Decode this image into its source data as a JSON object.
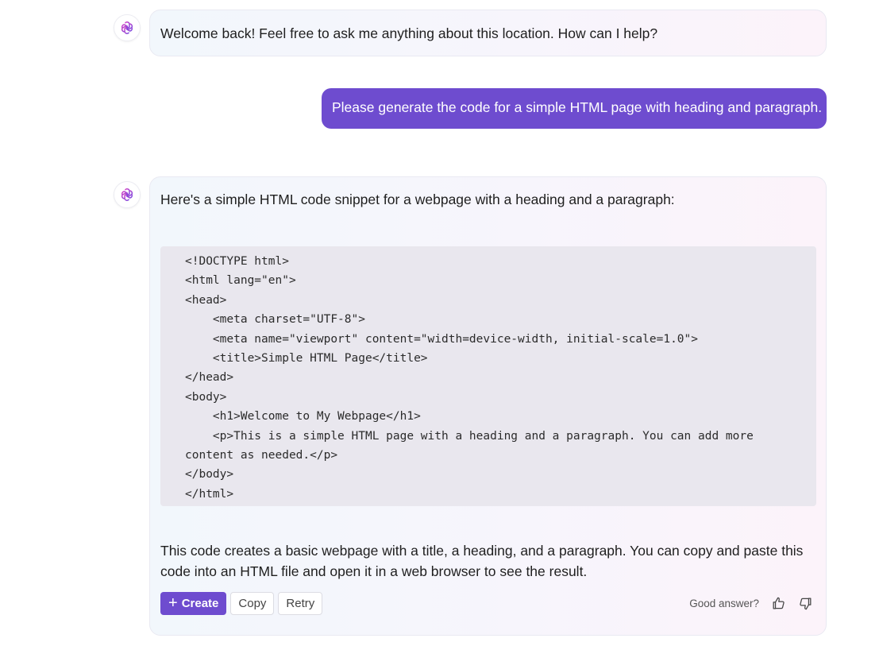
{
  "conversation": {
    "greeting": "Welcome back! Feel free to ask me anything about this location. How can I help?",
    "user_message": "Please generate the code for a simple HTML page with heading and paragraph.",
    "answer": {
      "intro": "Here's a simple HTML code snippet for a webpage with a heading and a paragraph:",
      "code_lines": [
        "<!DOCTYPE html>",
        "<html lang=\"en\">",
        "<head>",
        "    <meta charset=\"UTF-8\">",
        "    <meta name=\"viewport\" content=\"width=device-width, initial-scale=1.0\">",
        "    <title>Simple HTML Page</title>",
        "</head>",
        "<body>",
        "    <h1>Welcome to My Webpage</h1>",
        "    <p>This is a simple HTML page with a heading and a paragraph. You can add more",
        "content as needed.</p>",
        "</body>",
        "</html>"
      ],
      "outro": "This code creates a basic webpage with a title, a heading, and a paragraph. You can copy and paste this code into an HTML file and open it in a web browser to see the result."
    }
  },
  "actions": {
    "create_label": "Create",
    "create_icon": "plus-icon",
    "copy_label": "Copy",
    "retry_label": "Retry"
  },
  "feedback": {
    "label": "Good answer?",
    "like_icon": "thumbs-up-icon",
    "dislike_icon": "thumbs-down-icon"
  },
  "colors": {
    "accent": "#6e4ccf",
    "code_background": "#e9e7ee",
    "bubble_border": "#e9e9f2",
    "logo_gradient_start": "#d445c6",
    "logo_gradient_end": "#7a4ce0"
  }
}
